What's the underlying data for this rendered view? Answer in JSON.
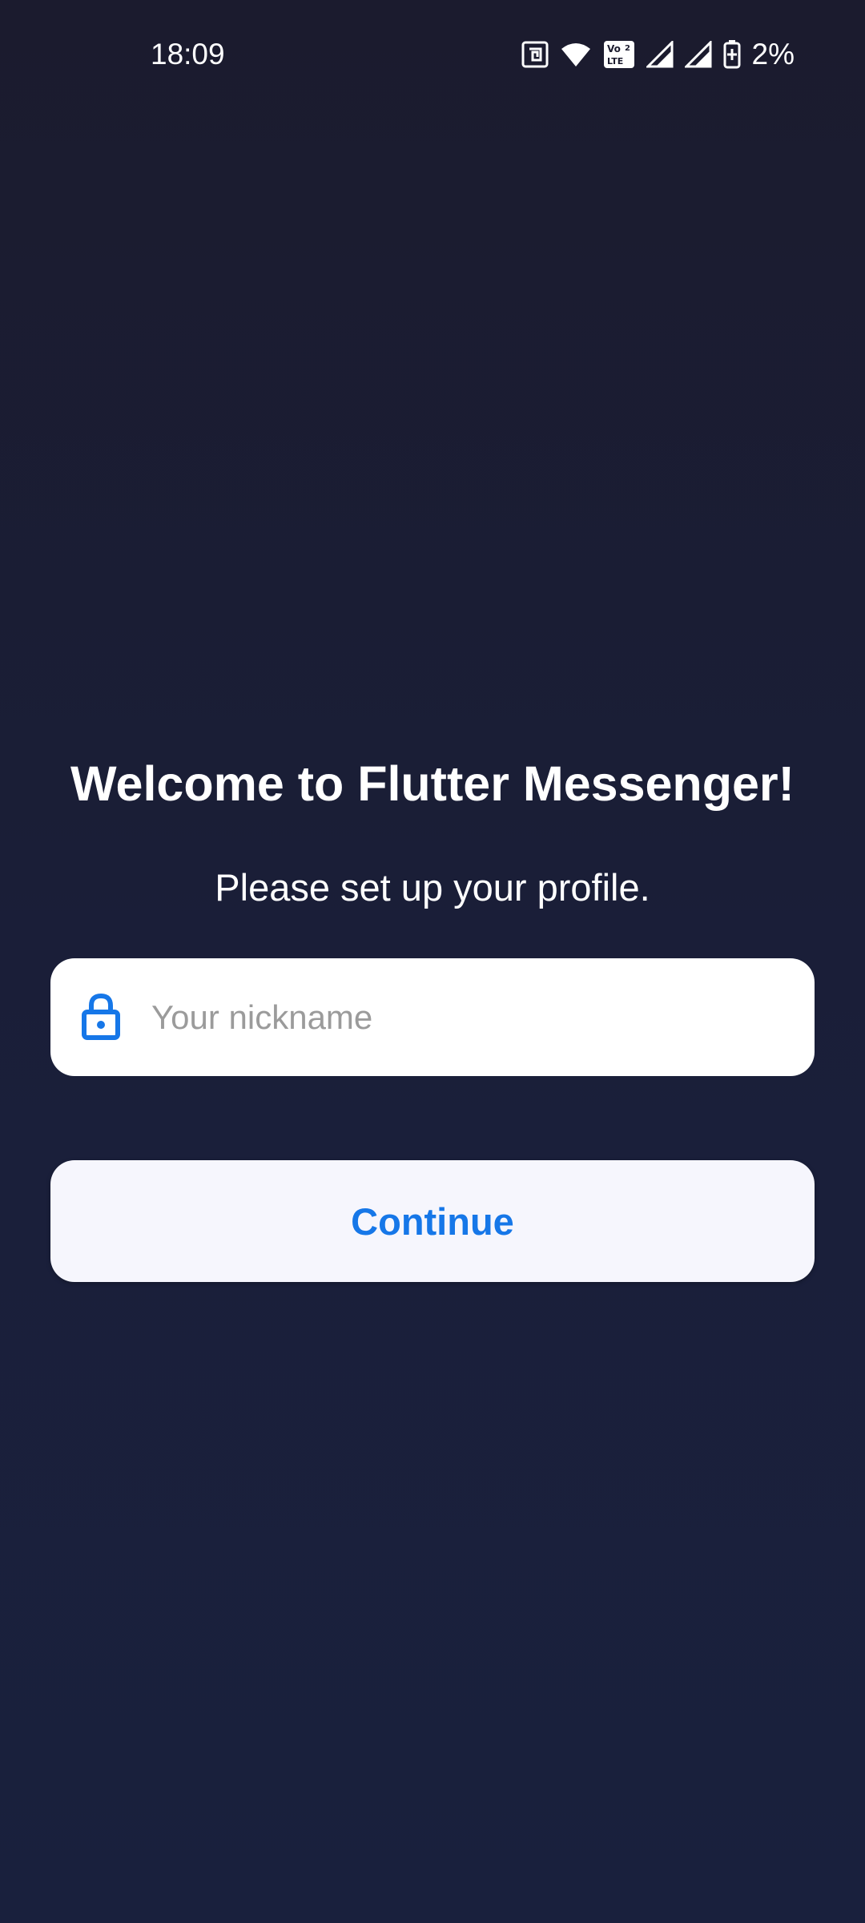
{
  "status_bar": {
    "time": "18:09",
    "battery_percent": "2%",
    "icons": [
      "nfc-icon",
      "wifi-icon",
      "volte-icon",
      "signal-icon",
      "signal-icon",
      "battery-charging-icon"
    ],
    "volte_label": "Vo LTE",
    "volte_sim": "2"
  },
  "main": {
    "title": "Welcome to Flutter Messenger!",
    "subtitle": "Please set up your profile.",
    "nickname_field": {
      "placeholder": "Your nickname",
      "value": "",
      "icon": "lock-icon"
    },
    "continue_label": "Continue"
  },
  "colors": {
    "background_top": "#1b1b2e",
    "background_bottom": "#19203d",
    "accent": "#1677e8",
    "button_bg": "#f6f6fd",
    "field_bg": "#ffffff",
    "placeholder": "#9b9b9b"
  }
}
